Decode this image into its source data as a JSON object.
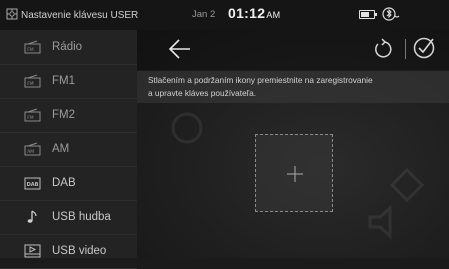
{
  "status_bar": {
    "title": "Nastavenie klávesu USER",
    "date": "Jan 2",
    "time": "01:12",
    "ampm": "AM",
    "icons": [
      "gear-icon",
      "battery-icon",
      "bluetooth-phone-icon"
    ]
  },
  "sidebar": {
    "items": [
      {
        "label": "Rádio",
        "icon": "radio-icon"
      },
      {
        "label": "FM1",
        "icon": "radio-icon"
      },
      {
        "label": "FM2",
        "icon": "radio-icon"
      },
      {
        "label": "AM",
        "icon": "radio-icon"
      },
      {
        "label": "DAB",
        "icon": "dab-icon"
      },
      {
        "label": "USB hudba",
        "icon": "music-note-icon"
      },
      {
        "label": "USB video",
        "icon": "video-icon"
      }
    ]
  },
  "toolbar": {
    "back": "back-arrow-icon",
    "reset": "reset-icon",
    "confirm": "confirm-check-icon"
  },
  "hint": {
    "line1": "Stlačením a podržaním ikony premiestnite na zaregistrovanie",
    "line2": "a upravte kláves používateľa."
  },
  "slot": {
    "icon": "plus-icon"
  }
}
